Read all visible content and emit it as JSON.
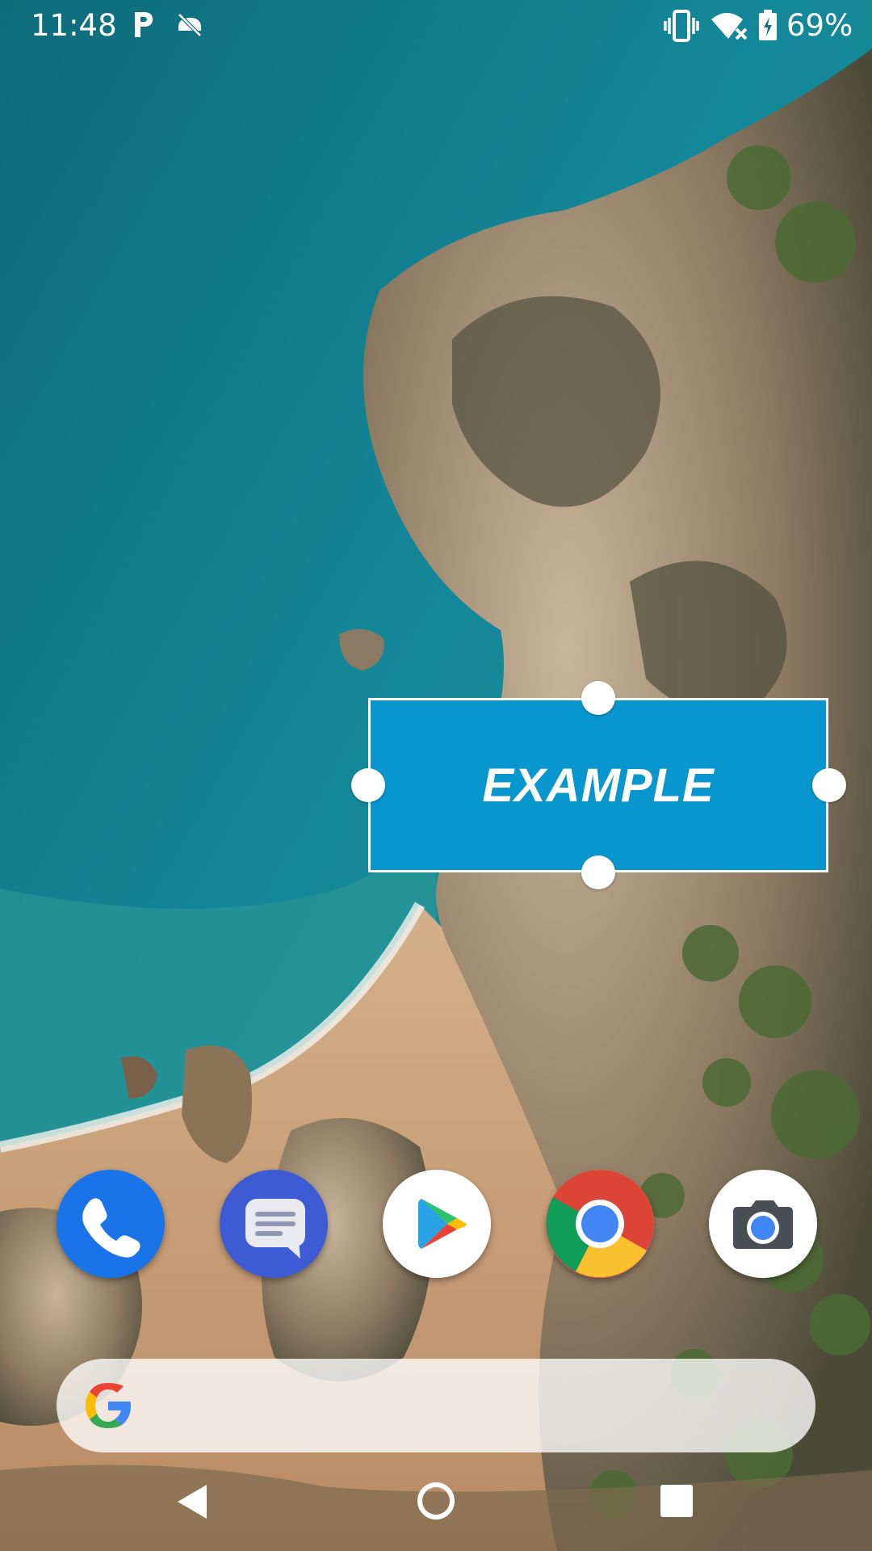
{
  "status_bar": {
    "time": "11:48",
    "battery_percent": "69%",
    "icons": [
      "parking-icon",
      "do-not-disturb-icon",
      "vibrate-icon",
      "wifi-no-internet-icon",
      "battery-charging-icon"
    ]
  },
  "widget": {
    "label": "EXAMPLE",
    "background_color": "#0896cf",
    "resize_handles": [
      "top",
      "left",
      "right",
      "bottom"
    ]
  },
  "dock": {
    "apps": [
      {
        "name": "phone-icon",
        "color": "#1a73e8"
      },
      {
        "name": "messages-icon",
        "color": "#3c5bd4"
      },
      {
        "name": "play-store-icon",
        "color": "#ffffff"
      },
      {
        "name": "chrome-icon",
        "color": "#ffffff"
      },
      {
        "name": "camera-icon",
        "color": "#ffffff"
      }
    ]
  },
  "search_bar": {
    "logo": "google-g-icon"
  },
  "nav_bar": {
    "buttons": [
      "back-button",
      "home-button",
      "recents-button"
    ]
  }
}
